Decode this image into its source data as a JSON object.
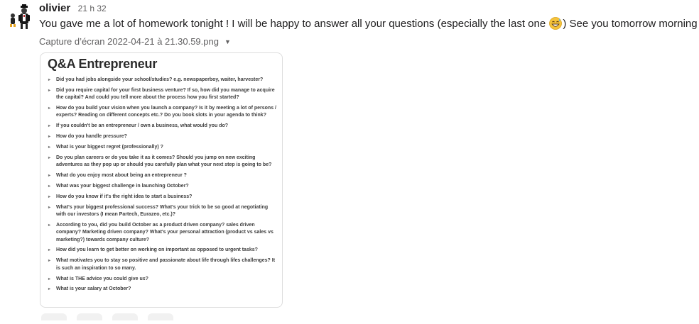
{
  "message": {
    "author": "olivier",
    "time": "21 h 32",
    "text_before_emoji": "You gave me a lot of homework tonight ! I will be happy to answer all your questions (especially the last one ",
    "emoji_icon": "grinning-sweat-emoji-icon",
    "text_after_emoji": ") See you tomorrow morning ! ("
  },
  "file": {
    "name": "Capture d’écran 2022-04-21 à 21.30.59.png",
    "caret_icon": "caret-down-icon"
  },
  "document": {
    "title": "Q&A Entrepreneur",
    "bullet_icon": "triangle-right-icon",
    "questions": [
      "Did you had jobs alongside your school/studies? e.g. newspaperboy, waiter, harvester?",
      "Did you require capital for your first business venture? If so, how did you manage to acquire the capital? And could you tell more about the process how you first started?",
      "How do you build your vision when you launch a company? Is it by meeting a lot of persons / experts? Reading on different concepts etc.? Do you book slots in your agenda to think?",
      "If you couldn't be an entrepreneur / own a business, what would you do?",
      "How do you handle pressure?",
      "What is your biggest regret (professionally) ?",
      "Do you plan careers or do you take it as it comes? Should you jump on new exciting adventures as they pop up or should you carefully plan what your next step is going to be?",
      "What do you enjoy most about being an entrepreneur ?",
      "What was your biggest challenge in launching October?",
      "How do you know if it's the right idea to start a business?",
      "What's your biggest professional success? What's your trick to be so good at negotiating with our investors (I mean Partech, Eurazeo, etc.)?",
      "According to you, did you build October as a product driven company? sales driven company? Marketing driven company? What's your personal attraction (product vs sales vs marketing?) towards company culture?",
      "How did you learn to get better on working on important as opposed to urgent tasks?",
      "What motivates you to stay so positive and passionate about life through lifes challenges? It is such an inspiration to so many.",
      "What is THE advice you could give us?",
      "What is your salary at October?"
    ]
  }
}
